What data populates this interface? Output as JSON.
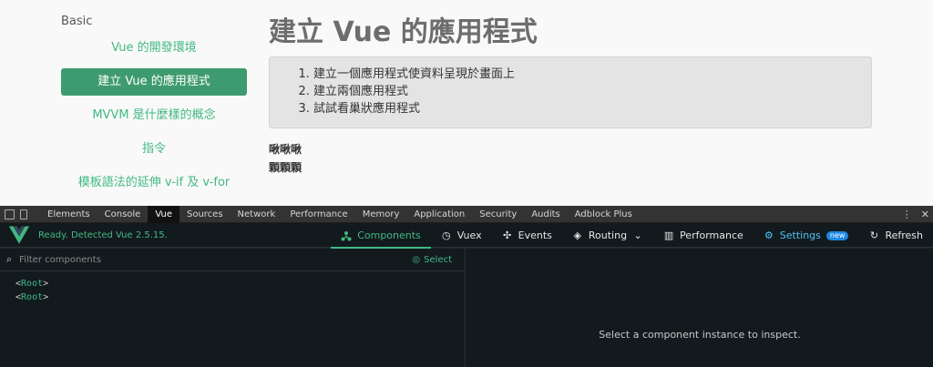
{
  "sidebar": {
    "heading": "Basic",
    "items": [
      {
        "label": "Vue 的開發環境",
        "active": false
      },
      {
        "label": "建立 Vue 的應用程式",
        "active": true
      },
      {
        "label": "MVVM 是什麼樣的概念",
        "active": false
      },
      {
        "label": "指令",
        "active": false
      },
      {
        "label": "模板語法的延伸 v-if 及 v-for",
        "active": false
      }
    ]
  },
  "main": {
    "title": "建立 Vue 的應用程式",
    "steps": [
      "建立一個應用程式使資料呈現於畫面上",
      "建立兩個應用程式",
      "試試看巢狀應用程式"
    ],
    "text_lines": [
      "啾啾啾",
      "顆顆顆"
    ]
  },
  "devtools": {
    "tabs": [
      "Elements",
      "Console",
      "Vue",
      "Sources",
      "Network",
      "Performance",
      "Memory",
      "Application",
      "Security",
      "Audits",
      "Adblock Plus"
    ],
    "active_tab": "Vue",
    "right_icons": [
      "more-icon",
      "close-icon"
    ]
  },
  "vue_devtools": {
    "status": "Ready. Detected Vue 2.5.15.",
    "toolbar": {
      "components": "Components",
      "vuex": "Vuex",
      "events": "Events",
      "routing": "Routing",
      "performance": "Performance",
      "settings": "Settings",
      "settings_badge": "new",
      "refresh": "Refresh"
    },
    "filter_placeholder": "Filter components",
    "select_label": "Select",
    "tree": [
      {
        "open": "<",
        "name": "Root",
        "close": ">"
      },
      {
        "open": "<",
        "name": "Root",
        "close": ">"
      }
    ],
    "inspect_message": "Select a component instance to inspect."
  },
  "colors": {
    "accent": "#42b983",
    "active_sidebar": "#3e9b6f",
    "settings": "#4fc3f7",
    "badge": "#1e88e5"
  }
}
